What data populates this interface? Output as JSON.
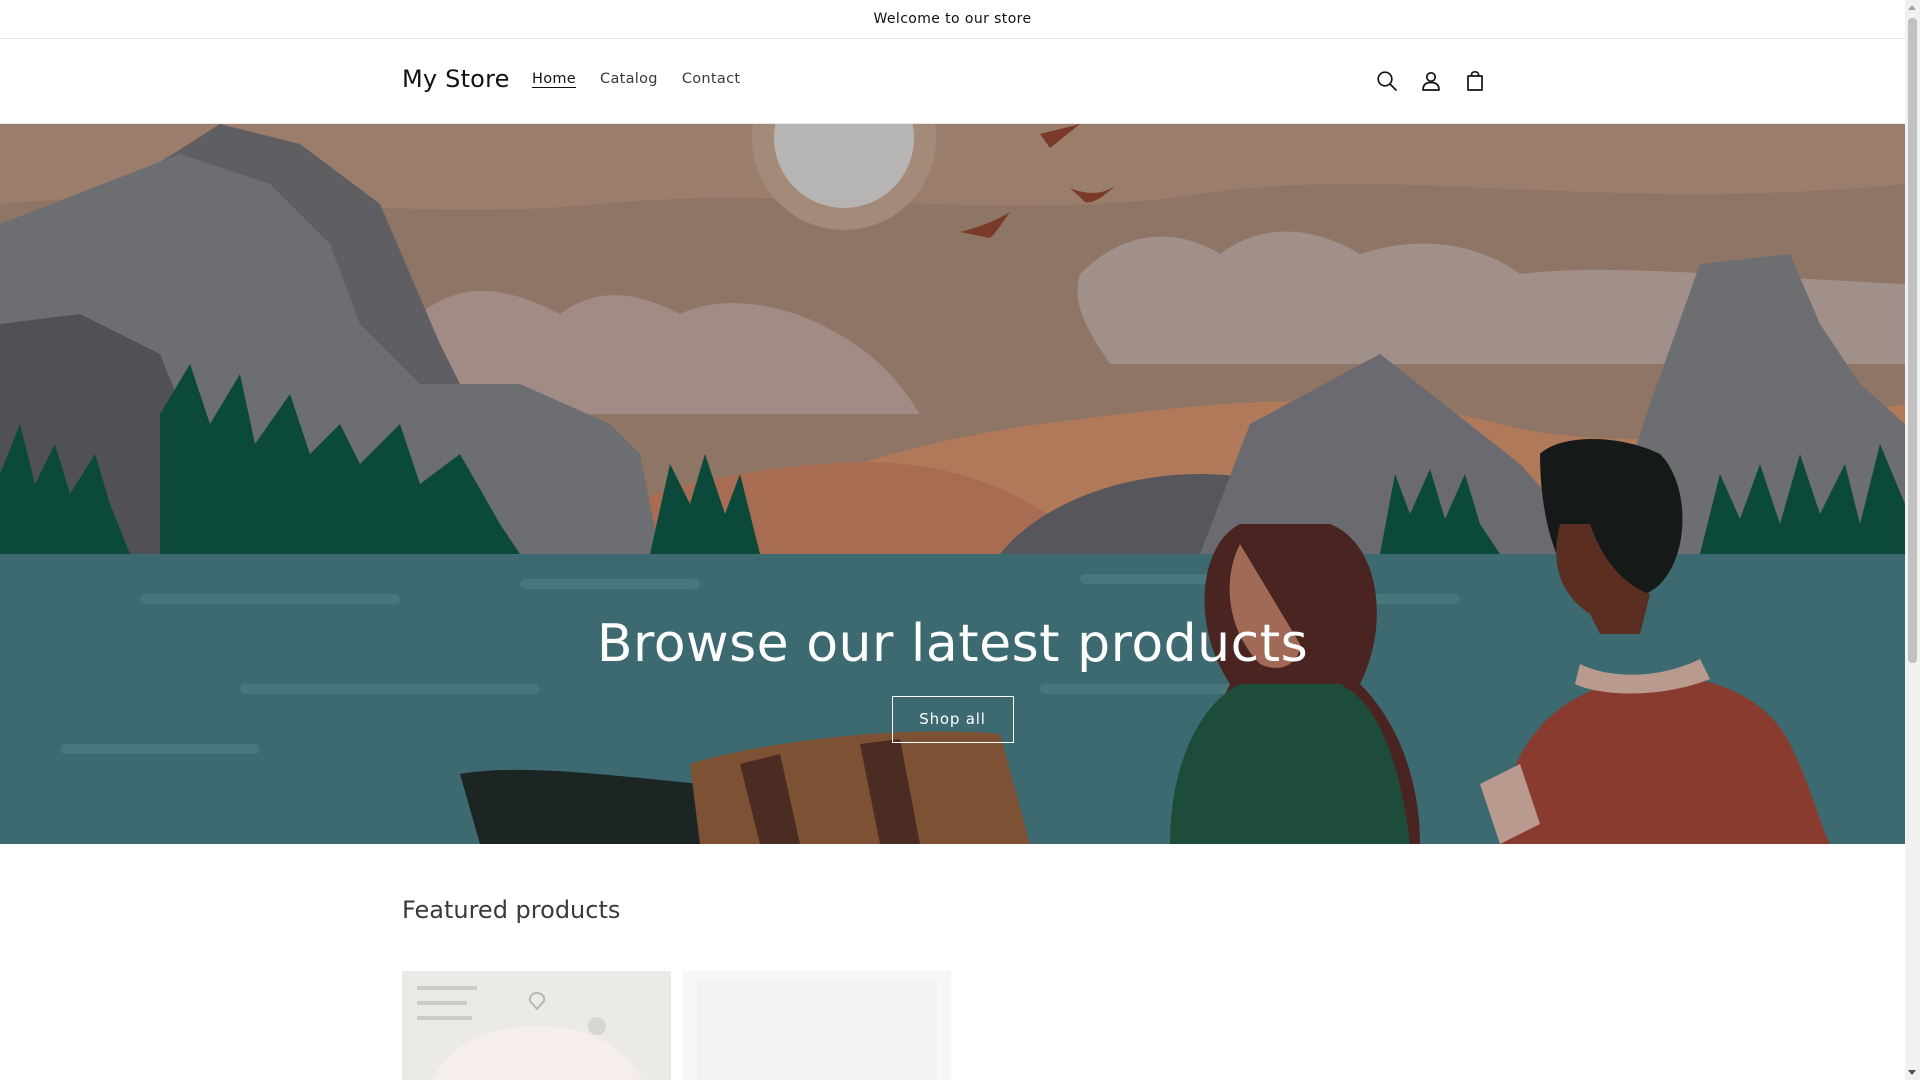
{
  "announcement": {
    "text": "Welcome to our store"
  },
  "header": {
    "logo": "My Store",
    "nav": [
      {
        "label": "Home",
        "active": true
      },
      {
        "label": "Catalog",
        "active": false
      },
      {
        "label": "Contact",
        "active": false
      }
    ],
    "icons": [
      "search-icon",
      "account-icon",
      "cart-icon"
    ]
  },
  "hero": {
    "title": "Browse our latest products",
    "button": "Shop all"
  },
  "featured": {
    "title": "Featured products"
  },
  "colors": {
    "sky": "#8e7565",
    "water": "#3c6a70",
    "mountain": "#6b6b6e",
    "trees": "#0d4a3c",
    "accent_red": "#8a3b2f"
  }
}
